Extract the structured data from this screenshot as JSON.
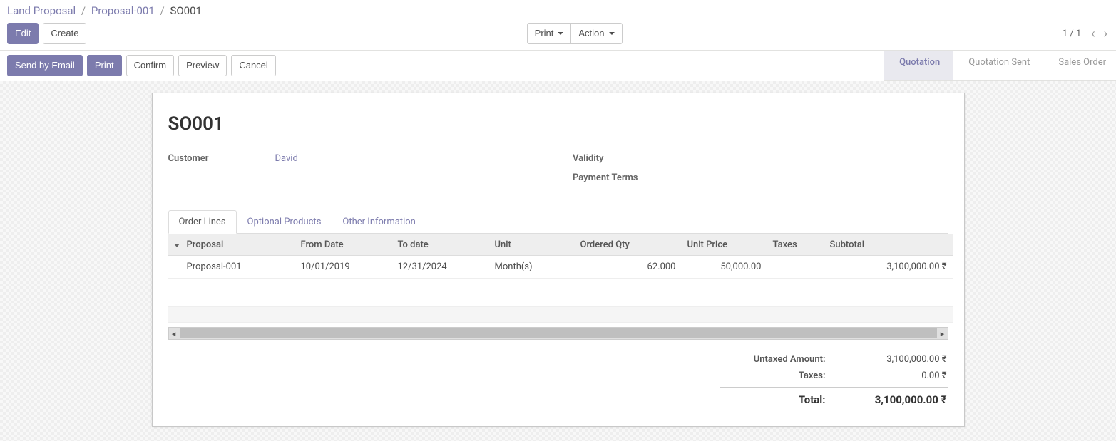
{
  "breadcrumb": {
    "root": "Land Proposal",
    "parent": "Proposal-001",
    "current": "SO001"
  },
  "toolbar": {
    "edit": "Edit",
    "create": "Create",
    "print": "Print",
    "action": "Action"
  },
  "pager": {
    "text": "1 / 1"
  },
  "actions": {
    "send_email": "Send by Email",
    "print": "Print",
    "confirm": "Confirm",
    "preview": "Preview",
    "cancel": "Cancel"
  },
  "status_steps": {
    "quotation": "Quotation",
    "quotation_sent": "Quotation Sent",
    "sales_order": "Sales Order"
  },
  "form": {
    "title": "SO001",
    "labels": {
      "customer": "Customer",
      "validity": "Validity",
      "payment_terms": "Payment Terms"
    },
    "values": {
      "customer": "David"
    }
  },
  "tabs": {
    "order_lines": "Order Lines",
    "optional_products": "Optional Products",
    "other_info": "Other Information"
  },
  "table": {
    "headers": {
      "proposal": "Proposal",
      "from_date": "From Date",
      "to_date": "To date",
      "unit": "Unit",
      "ordered_qty": "Ordered Qty",
      "unit_price": "Unit Price",
      "taxes": "Taxes",
      "subtotal": "Subtotal"
    },
    "rows": [
      {
        "proposal": "Proposal-001",
        "from_date": "10/01/2019",
        "to_date": "12/31/2024",
        "unit": "Month(s)",
        "ordered_qty": "62.000",
        "unit_price": "50,000.00",
        "taxes": "",
        "subtotal": "3,100,000.00 ₹"
      }
    ]
  },
  "totals": {
    "untaxed_label": "Untaxed Amount:",
    "untaxed_value": "3,100,000.00 ₹",
    "taxes_label": "Taxes:",
    "taxes_value": "0.00 ₹",
    "total_label": "Total:",
    "total_value": "3,100,000.00 ₹"
  }
}
